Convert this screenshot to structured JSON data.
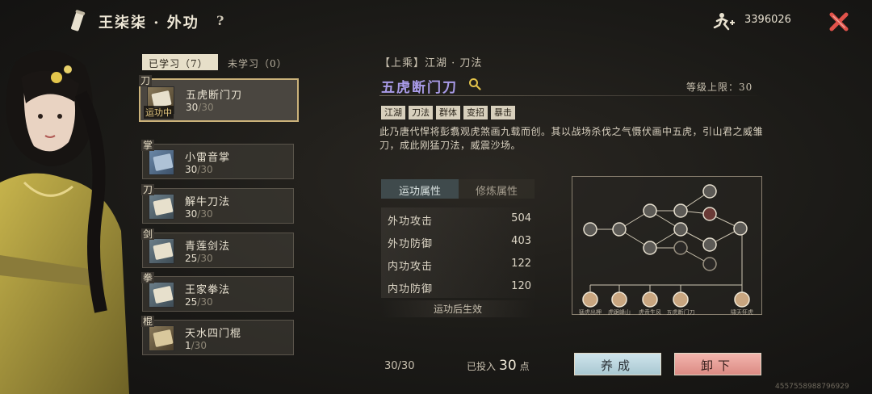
{
  "header": {
    "title": "王柒柒 · 外功",
    "help": "?",
    "currency_amount": "3396026"
  },
  "tabs": {
    "learned": "已学习（7）",
    "unlearned": "未学习（0）"
  },
  "skills": [
    {
      "type": "刀",
      "name": "五虎断门刀",
      "level": "30",
      "max": "/30",
      "badge": "运功中"
    },
    {
      "type": "掌",
      "name": "小雷音掌",
      "level": "30",
      "max": "/30"
    },
    {
      "type": "刀",
      "name": "解牛刀法",
      "level": "30",
      "max": "/30"
    },
    {
      "type": "剑",
      "name": "青莲剑法",
      "level": "25",
      "max": "/30"
    },
    {
      "type": "拳",
      "name": "王家拳法",
      "level": "25",
      "max": "/30"
    },
    {
      "type": "棍",
      "name": "天水四门棍",
      "level": "1",
      "max": "/30"
    }
  ],
  "detail": {
    "grade_line": "【上乘】江湖 · 刀法",
    "name": "五虎断门刀",
    "level_cap": "等级上限：30",
    "tags": [
      "江湖",
      "刀法",
      "群体",
      "变招",
      "暴击"
    ],
    "description": "此乃唐代悍将彭翥观虎煞画九载而创。其以战场杀伐之气慑伏画中五虎，引山君之威雏刀，成此刚猛刀法，威震沙场。"
  },
  "attributes": {
    "tab_active": "运功属性",
    "tab_inactive": "修炼属性",
    "rows": [
      {
        "name": "外功攻击",
        "value": "504"
      },
      {
        "name": "外功防御",
        "value": "403"
      },
      {
        "name": "内功攻击",
        "value": "122"
      },
      {
        "name": "内功防御",
        "value": "120"
      }
    ],
    "note": "运功后生效"
  },
  "tree": {
    "bottom_labels": [
      "猛虎出柙",
      "虎踞峰山",
      "虎贲生风",
      "五虎断门刀",
      "啸天狂虎"
    ]
  },
  "footer": {
    "progress": "30/30",
    "invested_prefix": "已投入",
    "invested_value": "30",
    "invested_suffix": "点",
    "train_button": "养成",
    "unequip_button": "卸下",
    "uid": "4557558988796929"
  },
  "colors": {
    "accent_gold": "#cbb27a",
    "skill_title": "#a99be8",
    "train_button": "#bcd8e1",
    "unequip_button": "#e9a39b",
    "close_red": "#e0524a"
  }
}
